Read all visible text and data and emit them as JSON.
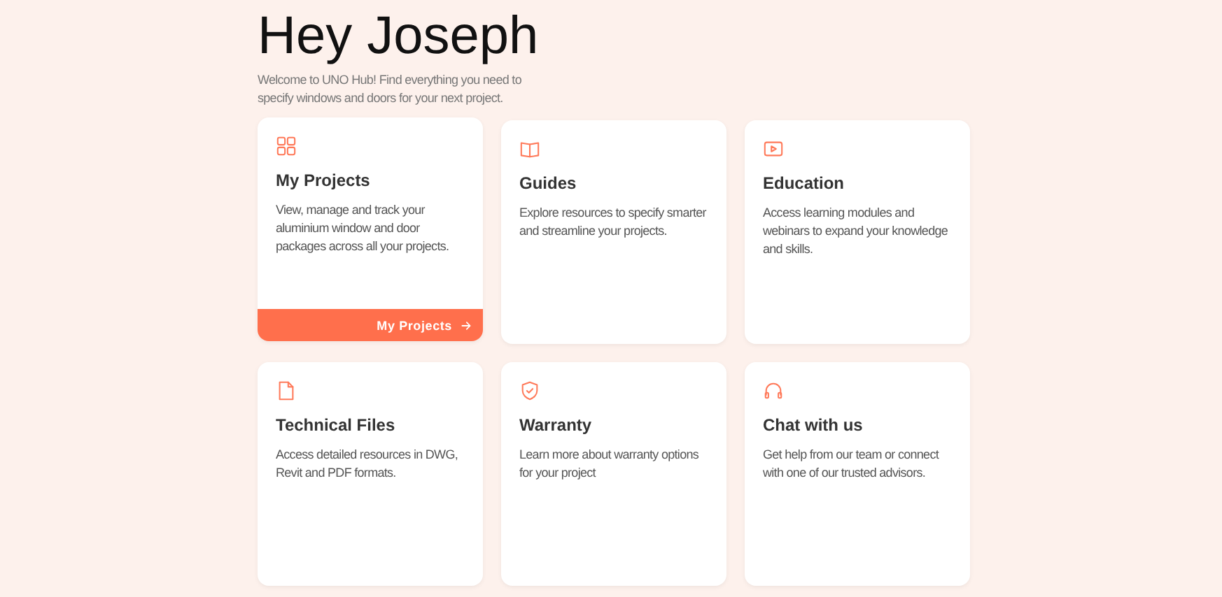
{
  "greeting": "Hey Joseph",
  "intro": "Welcome to UNO Hub! Find everything you need to specify windows and doors for your next project.",
  "cards": [
    {
      "title": "My Projects",
      "description": "View, manage and track your aluminium window and door packages across all your projects.",
      "button": "My Projects"
    },
    {
      "title": "Guides",
      "description": "Explore resources to specify smarter and streamline your projects."
    },
    {
      "title": "Education",
      "description": "Access learning modules and webinars to expand your knowledge and skills."
    },
    {
      "title": "Technical Files",
      "description": "Access detailed resources in DWG, Revit and PDF formats."
    },
    {
      "title": "Warranty",
      "description": "Learn more about warranty options for your project"
    },
    {
      "title": "Chat with us",
      "description": "Get help from our team or connect with one of our trusted advisors."
    }
  ]
}
